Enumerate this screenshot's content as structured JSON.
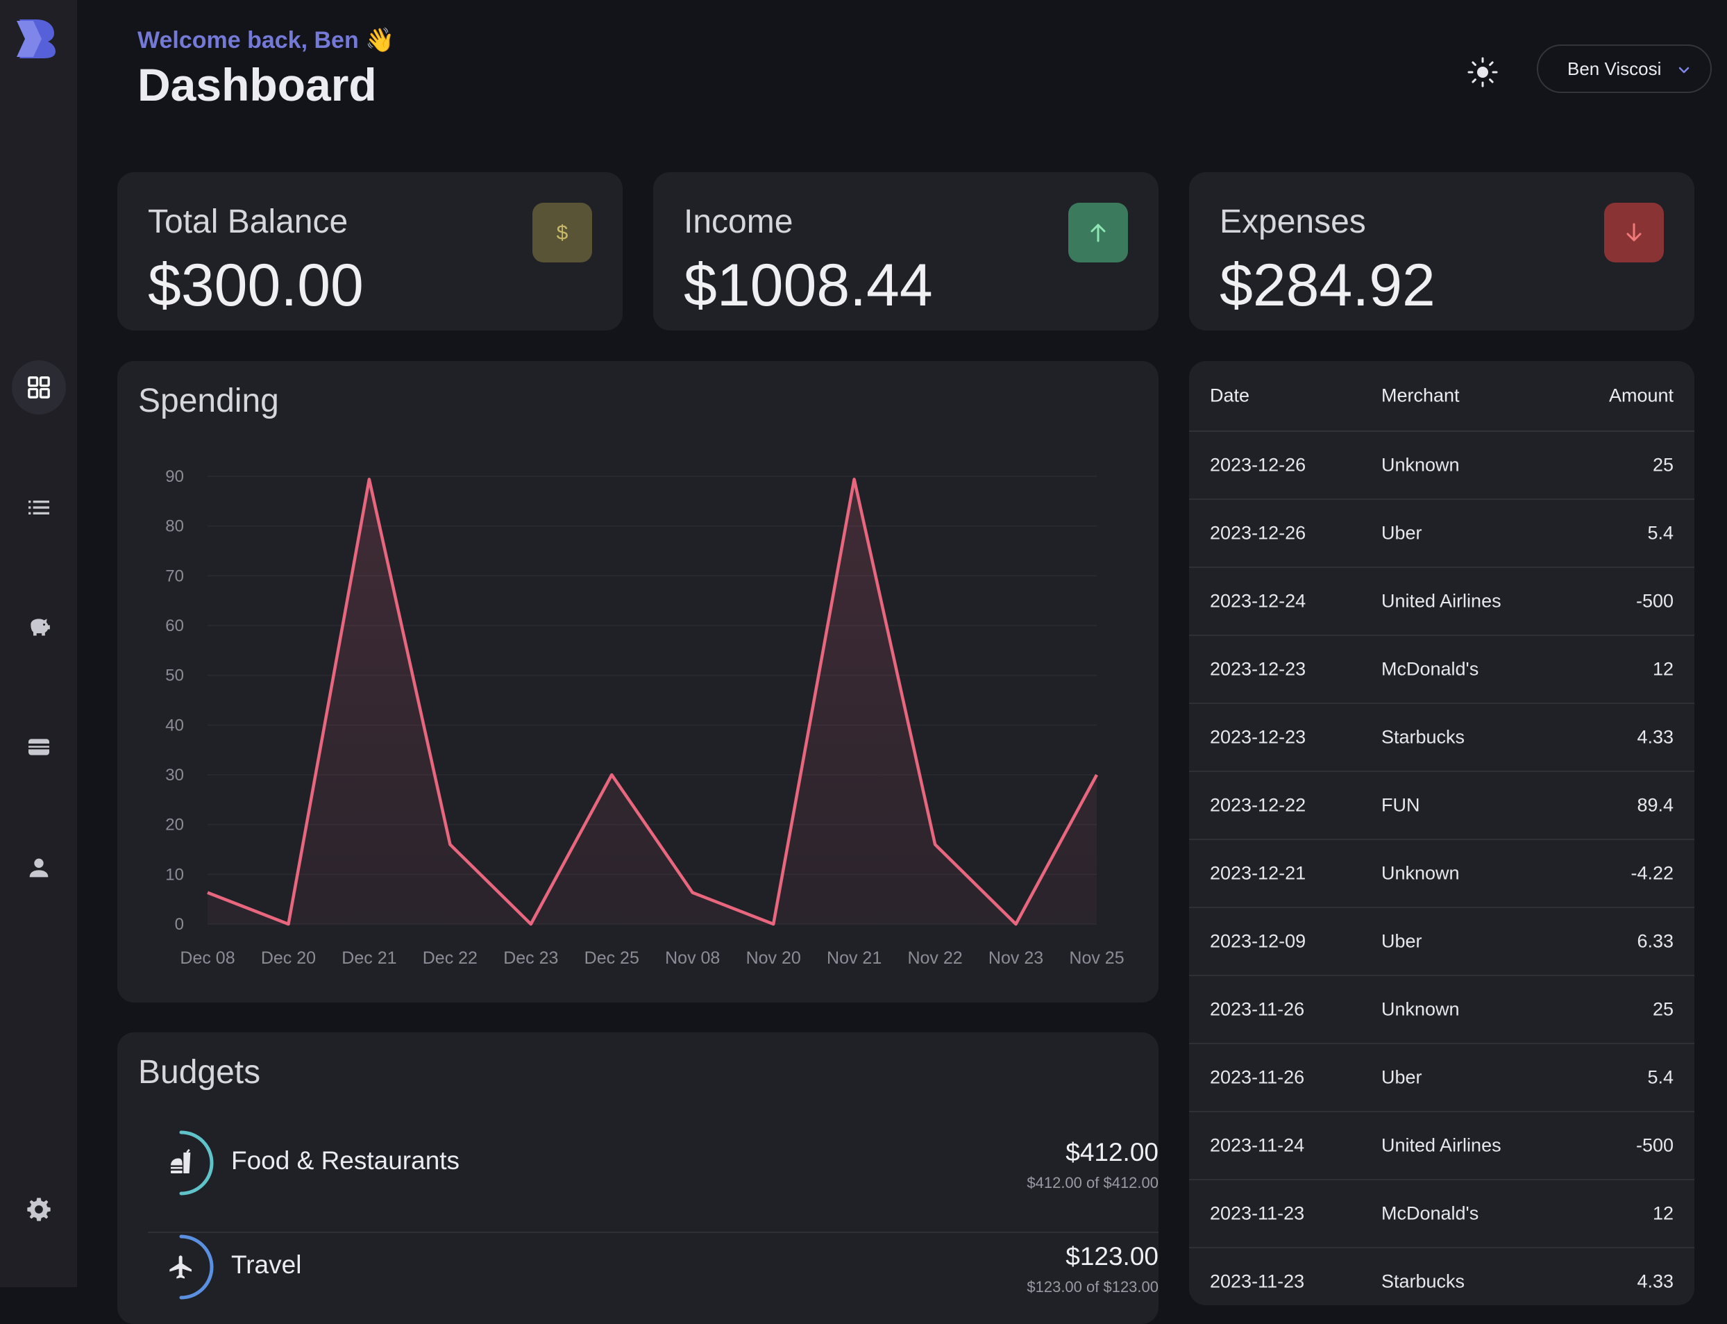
{
  "header": {
    "welcome": "Welcome back, Ben 👋",
    "title": "Dashboard",
    "user_name": "Ben Viscosi"
  },
  "stats": [
    {
      "label": "Total Balance",
      "value": "$300.00",
      "icon": "dollar-icon",
      "color": "#5a5436"
    },
    {
      "label": "Income",
      "value": "$1008.44",
      "icon": "arrow-up-icon",
      "color": "#3b7a5c"
    },
    {
      "label": "Expenses",
      "value": "$284.92",
      "icon": "arrow-down-icon",
      "color": "#8a3334"
    }
  ],
  "spending": {
    "title": "Spending"
  },
  "chart_data": {
    "type": "area",
    "title": "Spending",
    "categories": [
      "Dec 08",
      "Dec 20",
      "Dec 21",
      "Dec 22",
      "Dec 23",
      "Dec 25",
      "Nov 08",
      "Nov 20",
      "Nov 21",
      "Nov 22",
      "Nov 23",
      "Nov 25"
    ],
    "series": [
      {
        "values": [
          6.33,
          0,
          89.4,
          16,
          0,
          30,
          6.33,
          0,
          89.4,
          16,
          0,
          30
        ]
      }
    ],
    "yticks": [
      0,
      10,
      20,
      30,
      40,
      50,
      60,
      70,
      80,
      90
    ],
    "ylim": [
      0,
      90
    ],
    "line_color": "#e8677f",
    "grid": true
  },
  "transactions": {
    "columns": {
      "date": "Date",
      "merchant": "Merchant",
      "amount": "Amount"
    },
    "rows": [
      {
        "date": "2023-12-26",
        "merchant": "Unknown",
        "amount": "25"
      },
      {
        "date": "2023-12-26",
        "merchant": "Uber",
        "amount": "5.4"
      },
      {
        "date": "2023-12-24",
        "merchant": "United Airlines",
        "amount": "-500"
      },
      {
        "date": "2023-12-23",
        "merchant": "McDonald's",
        "amount": "12"
      },
      {
        "date": "2023-12-23",
        "merchant": "Starbucks",
        "amount": "4.33"
      },
      {
        "date": "2023-12-22",
        "merchant": "FUN",
        "amount": "89.4"
      },
      {
        "date": "2023-12-21",
        "merchant": "Unknown",
        "amount": "-4.22"
      },
      {
        "date": "2023-12-09",
        "merchant": "Uber",
        "amount": "6.33"
      },
      {
        "date": "2023-11-26",
        "merchant": "Unknown",
        "amount": "25"
      },
      {
        "date": "2023-11-26",
        "merchant": "Uber",
        "amount": "5.4"
      },
      {
        "date": "2023-11-24",
        "merchant": "United Airlines",
        "amount": "-500"
      },
      {
        "date": "2023-11-23",
        "merchant": "McDonald's",
        "amount": "12"
      },
      {
        "date": "2023-11-23",
        "merchant": "Starbucks",
        "amount": "4.33"
      }
    ]
  },
  "budgets": {
    "title": "Budgets",
    "items": [
      {
        "name": "Food & Restaurants",
        "amount": "$412.00",
        "detail": "$412.00 of $412.00",
        "icon": "fastfood-icon",
        "ring_color": "#5fc3c9",
        "progress": 1.0
      },
      {
        "name": "Travel",
        "amount": "$123.00",
        "detail": "$123.00 of $123.00",
        "icon": "airplane-icon",
        "ring_color": "#5b8fe0",
        "progress": 1.0
      }
    ]
  }
}
